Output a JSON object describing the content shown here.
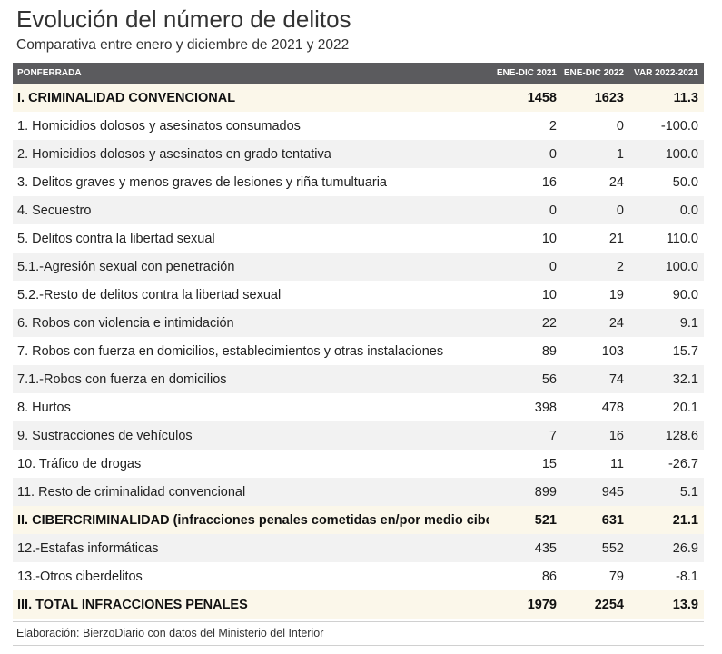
{
  "title": "Evolución del número de delitos",
  "subtitle": "Comparativa entre enero y diciembre de 2021 y 2022",
  "header": {
    "col0": "PONFERRADA",
    "col1": "ENE-DIC 2021",
    "col2": "ENE-DIC 2022",
    "col3": "VAR 2022-2021"
  },
  "rows": [
    {
      "label": "I. CRIMINALIDAD CONVENCIONAL",
      "v2021": "1458",
      "v2022": "1623",
      "var": "11.3",
      "highlight": true
    },
    {
      "label": "1. Homicidios dolosos y asesinatos consumados",
      "v2021": "2",
      "v2022": "0",
      "var": "-100.0",
      "highlight": false
    },
    {
      "label": "2. Homicidios dolosos y asesinatos en grado tentativa",
      "v2021": "0",
      "v2022": "1",
      "var": "100.0",
      "highlight": false
    },
    {
      "label": "3. Delitos graves y menos graves de lesiones y riña tumultuaria",
      "v2021": "16",
      "v2022": "24",
      "var": "50.0",
      "highlight": false
    },
    {
      "label": "4. Secuestro",
      "v2021": "0",
      "v2022": "0",
      "var": "0.0",
      "highlight": false
    },
    {
      "label": "5. Delitos contra la libertad sexual",
      "v2021": "10",
      "v2022": "21",
      "var": "110.0",
      "highlight": false
    },
    {
      "label": "5.1.-Agresión sexual con penetración",
      "v2021": "0",
      "v2022": "2",
      "var": "100.0",
      "highlight": false
    },
    {
      "label": "5.2.-Resto de delitos contra la libertad sexual",
      "v2021": "10",
      "v2022": "19",
      "var": "90.0",
      "highlight": false
    },
    {
      "label": "6. Robos con violencia e intimidación",
      "v2021": "22",
      "v2022": "24",
      "var": "9.1",
      "highlight": false
    },
    {
      "label": "7. Robos con fuerza en domicilios, establecimientos y otras instalaciones",
      "v2021": "89",
      "v2022": "103",
      "var": "15.7",
      "highlight": false
    },
    {
      "label": "7.1.-Robos con fuerza en domicilios",
      "v2021": "56",
      "v2022": "74",
      "var": "32.1",
      "highlight": false
    },
    {
      "label": "8. Hurtos",
      "v2021": "398",
      "v2022": "478",
      "var": "20.1",
      "highlight": false
    },
    {
      "label": "9. Sustracciones de vehículos",
      "v2021": "7",
      "v2022": "16",
      "var": "128.6",
      "highlight": false
    },
    {
      "label": "10. Tráfico de drogas",
      "v2021": "15",
      "v2022": "11",
      "var": "-26.7",
      "highlight": false
    },
    {
      "label": "11. Resto de criminalidad convencional",
      "v2021": "899",
      "v2022": "945",
      "var": "5.1",
      "highlight": false
    },
    {
      "label": "II. CIBERCRIMINALIDAD (infracciones penales cometidas en/por medio ciber)",
      "v2021": "521",
      "v2022": "631",
      "var": "21.1",
      "highlight": true
    },
    {
      "label": "12.-Estafas informáticas",
      "v2021": "435",
      "v2022": "552",
      "var": "26.9",
      "highlight": false
    },
    {
      "label": "13.-Otros ciberdelitos",
      "v2021": "86",
      "v2022": "79",
      "var": "-8.1",
      "highlight": false
    },
    {
      "label": "III. TOTAL INFRACCIONES PENALES",
      "v2021": "1979",
      "v2022": "2254",
      "var": "13.9",
      "highlight": true
    }
  ],
  "footer": "Elaboración: BierzoDiario con datos del Ministerio del Interior",
  "colors": {
    "header_bg": "#5b5b5e",
    "highlight_bg": "#fbf7ea",
    "stripe_bg": "#f2f2f2"
  }
}
